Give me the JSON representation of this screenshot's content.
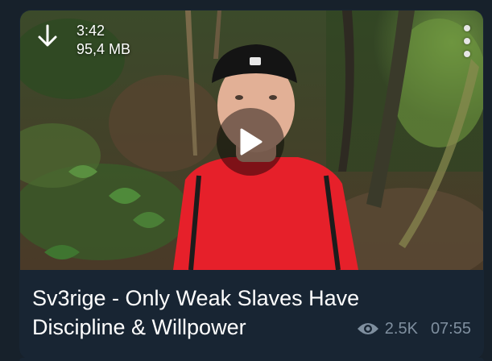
{
  "video": {
    "duration": "3:42",
    "file_size": "95,4 MB",
    "download_icon": "download-arrow-icon",
    "menu_icon": "more-vertical-icon",
    "play_icon": "play-icon"
  },
  "caption": {
    "text": "Sv3rige - Only Weak Slaves Have Discipline & Willpower"
  },
  "footer": {
    "views_icon": "eye-icon",
    "views": "2.5K",
    "time": "07:55"
  },
  "colors": {
    "background": "#17212b",
    "bubble": "#182533",
    "meta_text": "#7f8f9f",
    "shirt": "#e6202a"
  }
}
